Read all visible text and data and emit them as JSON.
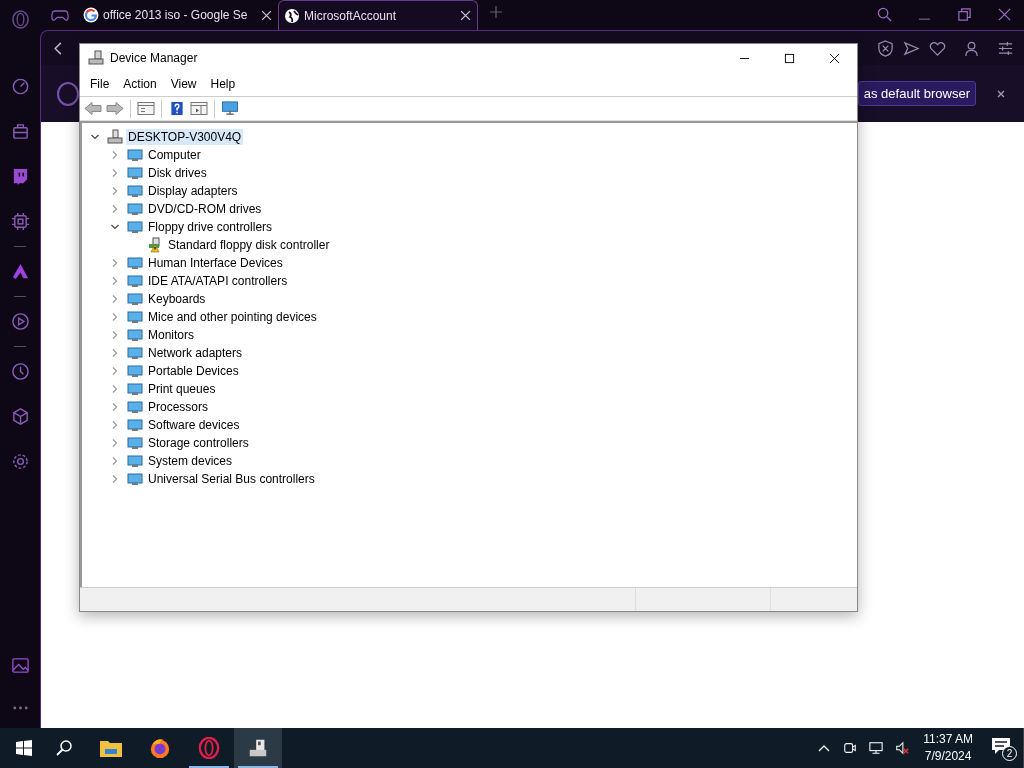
{
  "browser": {
    "tabs": [
      {
        "kind": "pinned",
        "selected": false
      },
      {
        "kind": "page",
        "title": "office 2013 iso - Google Se",
        "selected": false
      },
      {
        "kind": "page",
        "title": "MicrosoftAccount",
        "selected": true
      }
    ],
    "banner": {
      "button": "as default browser"
    }
  },
  "window": {
    "title": "Device Manager",
    "menu": [
      "File",
      "Action",
      "View",
      "Help"
    ],
    "tree": {
      "label": "DESKTOP-V300V4Q",
      "expanded": true,
      "selected": true,
      "children": [
        {
          "label": "Computer",
          "expanded": false,
          "selected": false
        },
        {
          "label": "Disk drives",
          "expanded": false,
          "selected": false
        },
        {
          "label": "Display adapters",
          "expanded": false,
          "selected": false
        },
        {
          "label": "DVD/CD-ROM drives",
          "expanded": false,
          "selected": false
        },
        {
          "label": "Floppy drive controllers",
          "expanded": true,
          "selected": false,
          "children": [
            {
              "label": "Standard floppy disk controller",
              "warning": true,
              "selected": false
            }
          ]
        },
        {
          "label": "Human Interface Devices",
          "expanded": false,
          "selected": false
        },
        {
          "label": "IDE ATA/ATAPI controllers",
          "expanded": false,
          "selected": false
        },
        {
          "label": "Keyboards",
          "expanded": false,
          "selected": false
        },
        {
          "label": "Mice and other pointing devices",
          "expanded": false,
          "selected": false
        },
        {
          "label": "Monitors",
          "expanded": false,
          "selected": false
        },
        {
          "label": "Network adapters",
          "expanded": false,
          "selected": false
        },
        {
          "label": "Portable Devices",
          "expanded": false,
          "selected": false
        },
        {
          "label": "Print queues",
          "expanded": false,
          "selected": false
        },
        {
          "label": "Processors",
          "expanded": false,
          "selected": false
        },
        {
          "label": "Software devices",
          "expanded": false,
          "selected": false
        },
        {
          "label": "Storage controllers",
          "expanded": false,
          "selected": false
        },
        {
          "label": "System devices",
          "expanded": false,
          "selected": false
        },
        {
          "label": "Universal Serial Bus controllers",
          "expanded": false,
          "selected": false
        }
      ]
    }
  },
  "taskbar": {
    "apps": [
      {
        "kind": "explorer",
        "running": false,
        "active": false
      },
      {
        "kind": "firefox",
        "running": false,
        "active": false
      },
      {
        "kind": "opera",
        "running": true,
        "active": false
      },
      {
        "kind": "devices",
        "running": true,
        "active": true
      }
    ],
    "time": "11:37 AM",
    "date": "7/9/2024",
    "notifications": "2"
  }
}
